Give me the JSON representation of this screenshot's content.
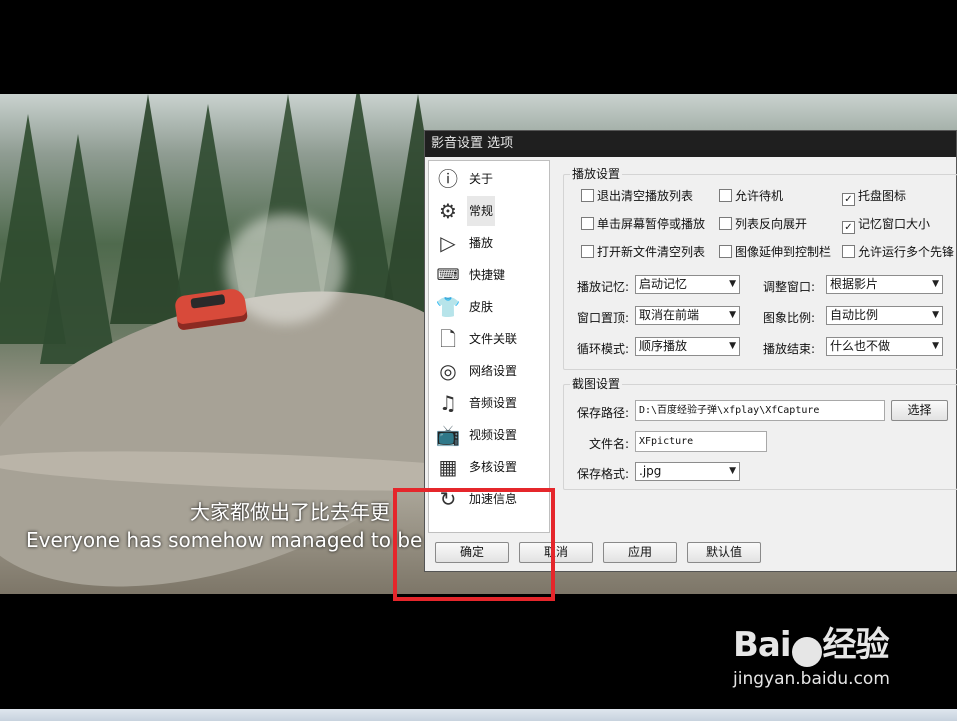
{
  "subtitles": {
    "chinese": "大家都做出了比去年更",
    "english": "Everyone has somehow managed to be fas"
  },
  "dialog": {
    "title": "影音设置 选项",
    "nav": [
      {
        "label": "关于",
        "icon": "info-icon"
      },
      {
        "label": "常规",
        "icon": "gear-icon",
        "selected": true
      },
      {
        "label": "播放",
        "icon": "play-icon"
      },
      {
        "label": "快捷键",
        "icon": "keyboard-icon"
      },
      {
        "label": "皮肤",
        "icon": "shirt-icon"
      },
      {
        "label": "文件关联",
        "icon": "file-icon"
      },
      {
        "label": "网络设置",
        "icon": "network-icon"
      },
      {
        "label": "音频设置",
        "icon": "audio-icon"
      },
      {
        "label": "视频设置",
        "icon": "tv-icon"
      },
      {
        "label": "多核设置",
        "icon": "multicore-icon"
      },
      {
        "label": "加速信息",
        "icon": "accelerate-icon"
      }
    ],
    "playback": {
      "title": "播放设置",
      "checkboxes": [
        {
          "label": "退出清空播放列表",
          "checked": false
        },
        {
          "label": "允许待机",
          "checked": false
        },
        {
          "label": "托盘图标",
          "checked": true
        },
        {
          "label": "单击屏幕暂停或播放",
          "checked": false
        },
        {
          "label": "列表反向展开",
          "checked": false
        },
        {
          "label": "记忆窗口大小",
          "checked": true
        },
        {
          "label": "打开新文件清空列表",
          "checked": false
        },
        {
          "label": "图像延伸到控制栏",
          "checked": false
        },
        {
          "label": "允许运行多个先锋",
          "checked": false
        }
      ],
      "selects": [
        {
          "label": "播放记忆:",
          "value": "启动记忆"
        },
        {
          "label": "调整窗口:",
          "value": "根据影片"
        },
        {
          "label": "窗口置顶:",
          "value": "取消在前端"
        },
        {
          "label": "图象比例:",
          "value": "自动比例"
        },
        {
          "label": "循环模式:",
          "value": "顺序播放"
        },
        {
          "label": "播放结束:",
          "value": "什么也不做"
        }
      ]
    },
    "capture": {
      "title": "截图设置",
      "path_label": "保存路径:",
      "path_value": "D:\\百度经验子弹\\xfplay\\XfCapture",
      "browse_label": "选择",
      "filename_label": "文件名:",
      "filename_value": "XFpicture",
      "format_label": "保存格式:",
      "format_value": ".jpg"
    },
    "buttons": {
      "ok": "确定",
      "cancel": "取消",
      "apply": "应用",
      "default": "默认值"
    }
  },
  "watermark": {
    "logo": "Bai",
    "logo_tail": "经验",
    "url": "jingyan.baidu.com"
  },
  "colors": {
    "highlight": "#e5262b",
    "titlebar": "#1f1f1f"
  }
}
